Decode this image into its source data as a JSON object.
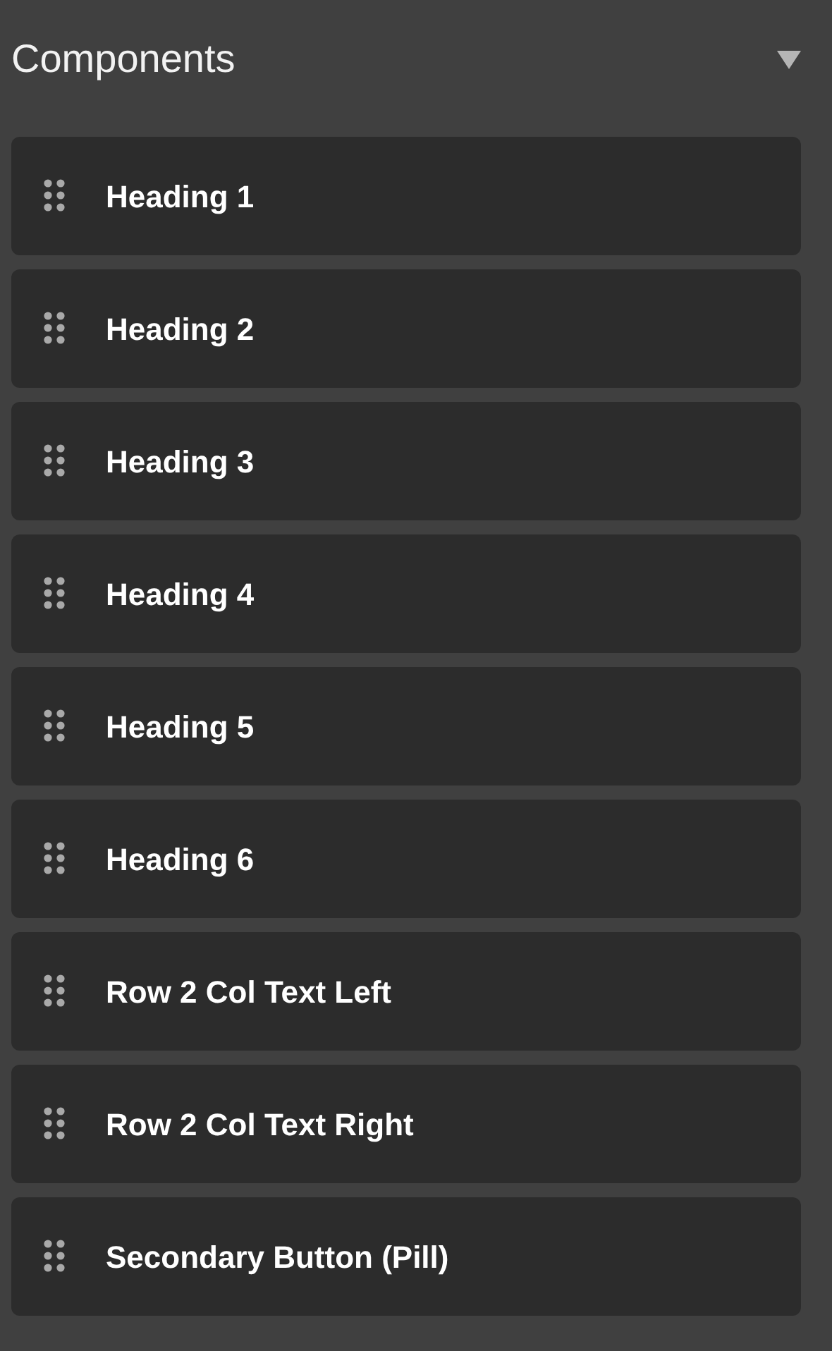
{
  "panel": {
    "title": "Components",
    "expanded": true
  },
  "components": [
    {
      "label": "Heading 1"
    },
    {
      "label": "Heading 2"
    },
    {
      "label": "Heading 3"
    },
    {
      "label": "Heading 4"
    },
    {
      "label": "Heading 5"
    },
    {
      "label": "Heading 6"
    },
    {
      "label": "Row 2 Col Text Left"
    },
    {
      "label": "Row 2 Col Text Right"
    },
    {
      "label": "Secondary Button (Pill)"
    }
  ]
}
